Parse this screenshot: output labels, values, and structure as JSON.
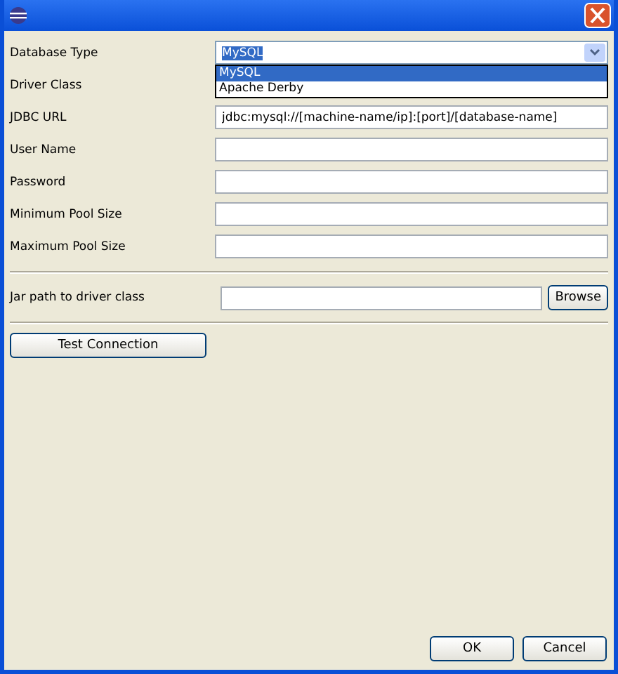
{
  "database_type": {
    "label": "Database Type",
    "value": "MySQL",
    "expanded": true,
    "options": [
      {
        "label": "MySQL",
        "selected": true
      },
      {
        "label": "Apache Derby",
        "selected": false
      }
    ]
  },
  "fields": [
    {
      "label": "Driver Class"
    },
    {
      "label": "JDBC URL",
      "value": "jdbc:mysql://[machine-name/ip]:[port]/[database-name]"
    },
    {
      "label": "User Name"
    },
    {
      "label": "Password"
    },
    {
      "label": "Minimum Pool Size"
    },
    {
      "label": "Maximum Pool Size"
    }
  ],
  "jar_path": {
    "label": "Jar path to driver class",
    "button": "Browse"
  },
  "test_button": "Test Connection",
  "buttons": [
    "OK",
    "Cancel"
  ]
}
